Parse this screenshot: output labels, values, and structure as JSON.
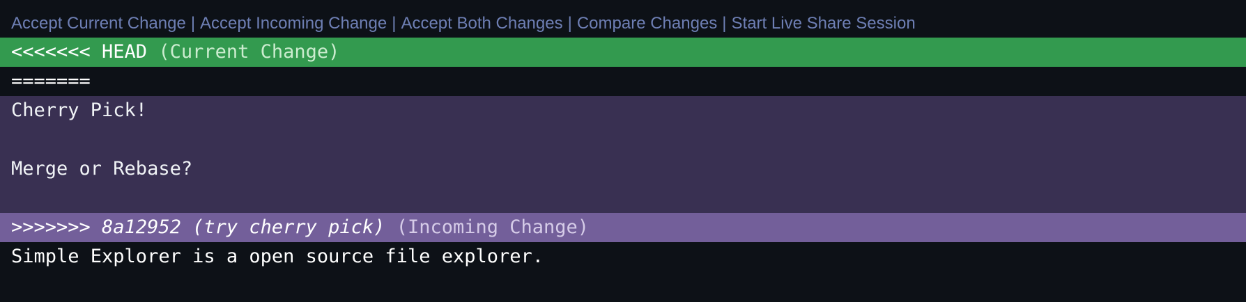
{
  "codelens": {
    "accept_current": "Accept Current Change",
    "accept_incoming": "Accept Incoming Change",
    "accept_both": "Accept Both Changes",
    "compare": "Compare Changes",
    "live_share": "Start Live Share Session",
    "separator": "|"
  },
  "conflict": {
    "current_marker": "<<<<<<< HEAD",
    "current_label": "(Current Change)",
    "divider": "=======",
    "incoming_lines": [
      "Cherry Pick!",
      "",
      "Merge or Rebase?",
      ""
    ],
    "incoming_marker": ">>>>>>> 8a12952 (try cherry pick)",
    "incoming_label": "(Incoming Change)"
  },
  "after_conflict": "Simple Explorer is a open source file explorer.",
  "colors": {
    "background": "#0d1117",
    "current_header": "#339a4f",
    "incoming_body": "#393052",
    "incoming_header": "#735f9a",
    "codelens_text": "#6e7fb4"
  }
}
